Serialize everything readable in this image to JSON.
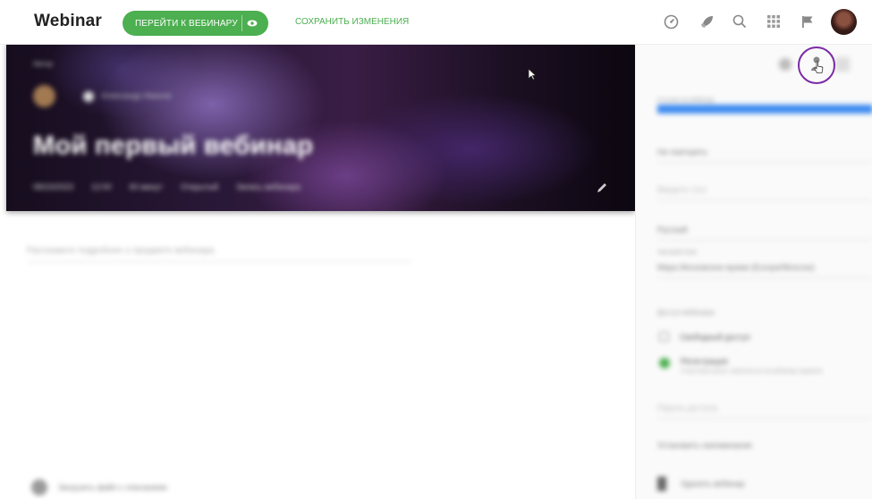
{
  "header": {
    "logo": "Webinar",
    "go_button_label": "ПЕРЕЙТИ К ВЕБИНАРУ",
    "save_link_label": "СОХРАНИТЬ ИЗМЕНЕНИЯ",
    "icons": [
      "speedometer-icon",
      "rocket-icon",
      "search-icon",
      "grid-icon",
      "flag-icon"
    ],
    "accent_color": "#4caf50"
  },
  "banner": {
    "label": "Автор",
    "author": "Александр Иванов",
    "title": "Мой первый вебинар",
    "date": "08/23/2023",
    "time": "12:00",
    "duration": "60 минут",
    "tag": "Открытый",
    "extra": "Запись вебинара"
  },
  "main": {
    "description_placeholder": "Расскажите подробнее о предмете вебинара",
    "footer_link": "Загрузить файл с описанием"
  },
  "sidebar": {
    "highlight_color": "#3d8bf0",
    "selection_label": "Ссылка на вебинар",
    "field_1": "Не повторять",
    "field_2_placeholder": "Введите тэги",
    "field_3": "Русский",
    "field_4_label": "Часовой пояс",
    "field_4_value": "Мира Московское время (Europe/Moscow)",
    "section_label": "Доступ вебинара",
    "checkbox_label": "Свободный доступ",
    "radio_label": "Регистрация",
    "radio_sub": "Участники могут записаться на вебинар заранее",
    "password_placeholder": "Пароль доступа",
    "notifications_label": "Установить напоминания",
    "bottom_link": "Удалить вебинар"
  }
}
